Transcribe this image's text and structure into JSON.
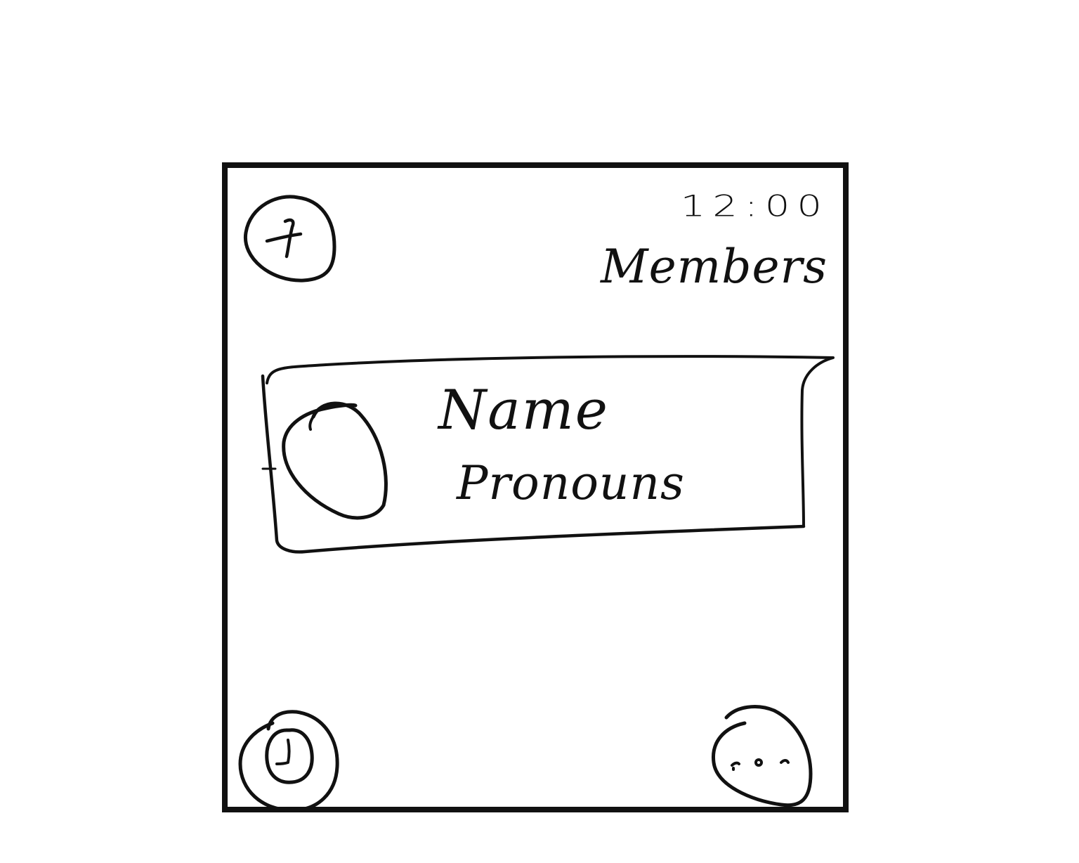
{
  "status_bar": {
    "time": "12:00"
  },
  "header": {
    "title": "Members",
    "add_button_icon": "plus-icon"
  },
  "members": [
    {
      "name": "Name",
      "pronouns": "Pronouns",
      "avatar_icon": "avatar-circle-icon"
    }
  ],
  "bottom_bar": {
    "left_icon": "clock-icon",
    "right_icon": "more-icon"
  }
}
